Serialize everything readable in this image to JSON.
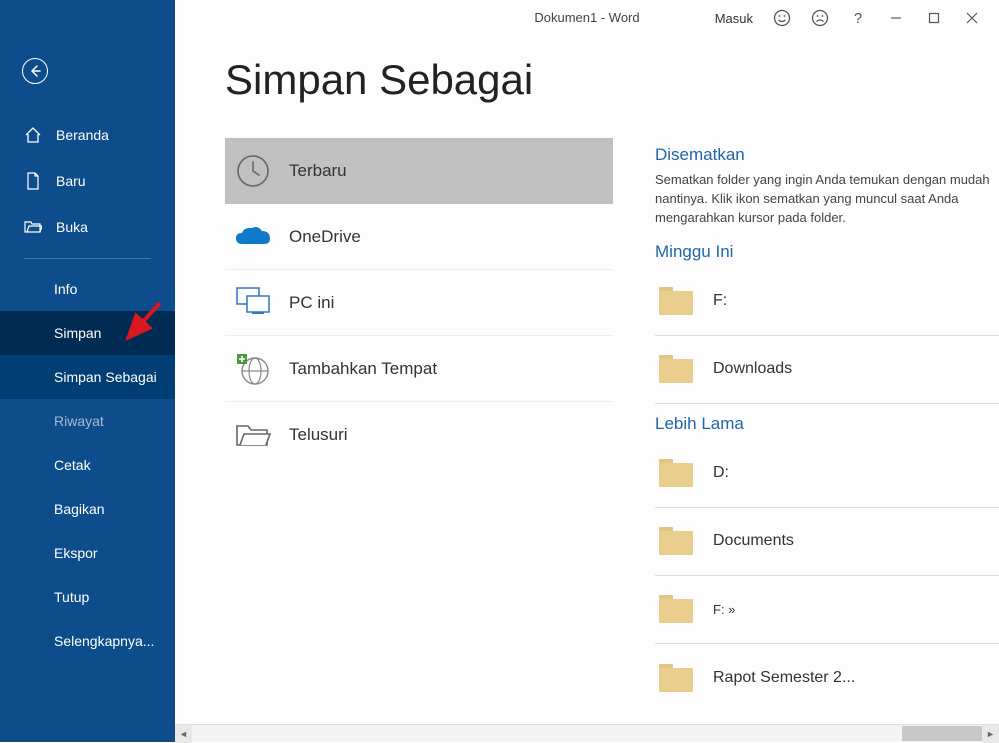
{
  "titlebar": {
    "doc_title": "Dokumen1  -  Word",
    "signin": "Masuk"
  },
  "sidebar": {
    "items": [
      {
        "label": "Beranda"
      },
      {
        "label": "Baru"
      },
      {
        "label": "Buka"
      },
      {
        "label": "Info"
      },
      {
        "label": "Simpan"
      },
      {
        "label": "Simpan Sebagai"
      },
      {
        "label": "Riwayat"
      },
      {
        "label": "Cetak"
      },
      {
        "label": "Bagikan"
      },
      {
        "label": "Ekspor"
      },
      {
        "label": "Tutup"
      },
      {
        "label": "Selengkapnya..."
      }
    ]
  },
  "page": {
    "title": "Simpan Sebagai"
  },
  "locations": {
    "recent": "Terbaru",
    "onedrive": "OneDrive",
    "thispc": "PC ini",
    "addplace": "Tambahkan Tempat",
    "browse": "Telusuri"
  },
  "right": {
    "pinned_title": "Disematkan",
    "pinned_desc": "Sematkan folder yang ingin Anda temukan dengan mudah nantinya. Klik ikon sematkan yang muncul saat Anda mengarahkan kursor pada folder.",
    "thisweek_title": "Minggu Ini",
    "older_title": "Lebih Lama",
    "thisweek": [
      {
        "label": "F:"
      },
      {
        "label": "Downloads"
      }
    ],
    "older": [
      {
        "label": "D:"
      },
      {
        "label": "Documents"
      },
      {
        "label": "F: »",
        "small": true
      },
      {
        "label": "Rapot Semester 2..."
      }
    ]
  }
}
